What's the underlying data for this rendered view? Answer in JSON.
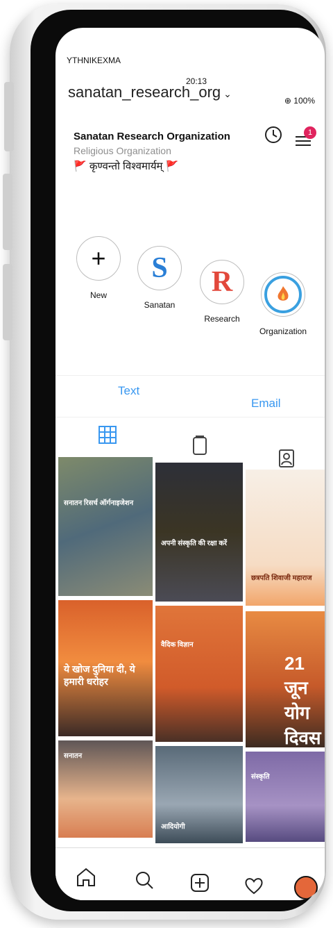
{
  "status_bar": {
    "carrier": "YTHNIKEXMA",
    "time": "20:13",
    "battery": "⊕ 100%"
  },
  "header": {
    "username": "sanatan_research_org",
    "notification_count": "1"
  },
  "bio": {
    "name": "Sanatan Research Organization",
    "category": "Religious Organization",
    "motto": "🚩 कृण्वन्तो विश्वमार्यम् 🚩"
  },
  "highlights": [
    {
      "label": "New",
      "symbol": "+"
    },
    {
      "label": "Sanatan",
      "symbol": "S"
    },
    {
      "label": "Research",
      "symbol": "R"
    },
    {
      "label": "Organization",
      "symbol": "org-logo-icon"
    }
  ],
  "actions": {
    "text": "Text",
    "email": "Email"
  },
  "colors": {
    "link": "#3897f0",
    "badge": "#e0245e"
  },
  "grid_posts": [
    {
      "text": "सनातन रिसर्च ऑर्गनाइजेशन"
    },
    {
      "text": "अपनी संस्कृति की रक्षा करें"
    },
    {
      "text": "छत्रपति शिवाजी महाराज"
    },
    {
      "text": "ये खोज दुनिया दी, ये हमारी धरोहर"
    },
    {
      "text": "वैदिक विज्ञान"
    },
    {
      "text": "21 जून योग दिवस"
    },
    {
      "text": "सनातन"
    },
    {
      "text": "आदियोगी"
    },
    {
      "text": "संस्कृति"
    }
  ],
  "bottom_nav": [
    "home-icon",
    "search-icon",
    "add-post-icon",
    "heart-icon",
    "profile-avatar"
  ]
}
